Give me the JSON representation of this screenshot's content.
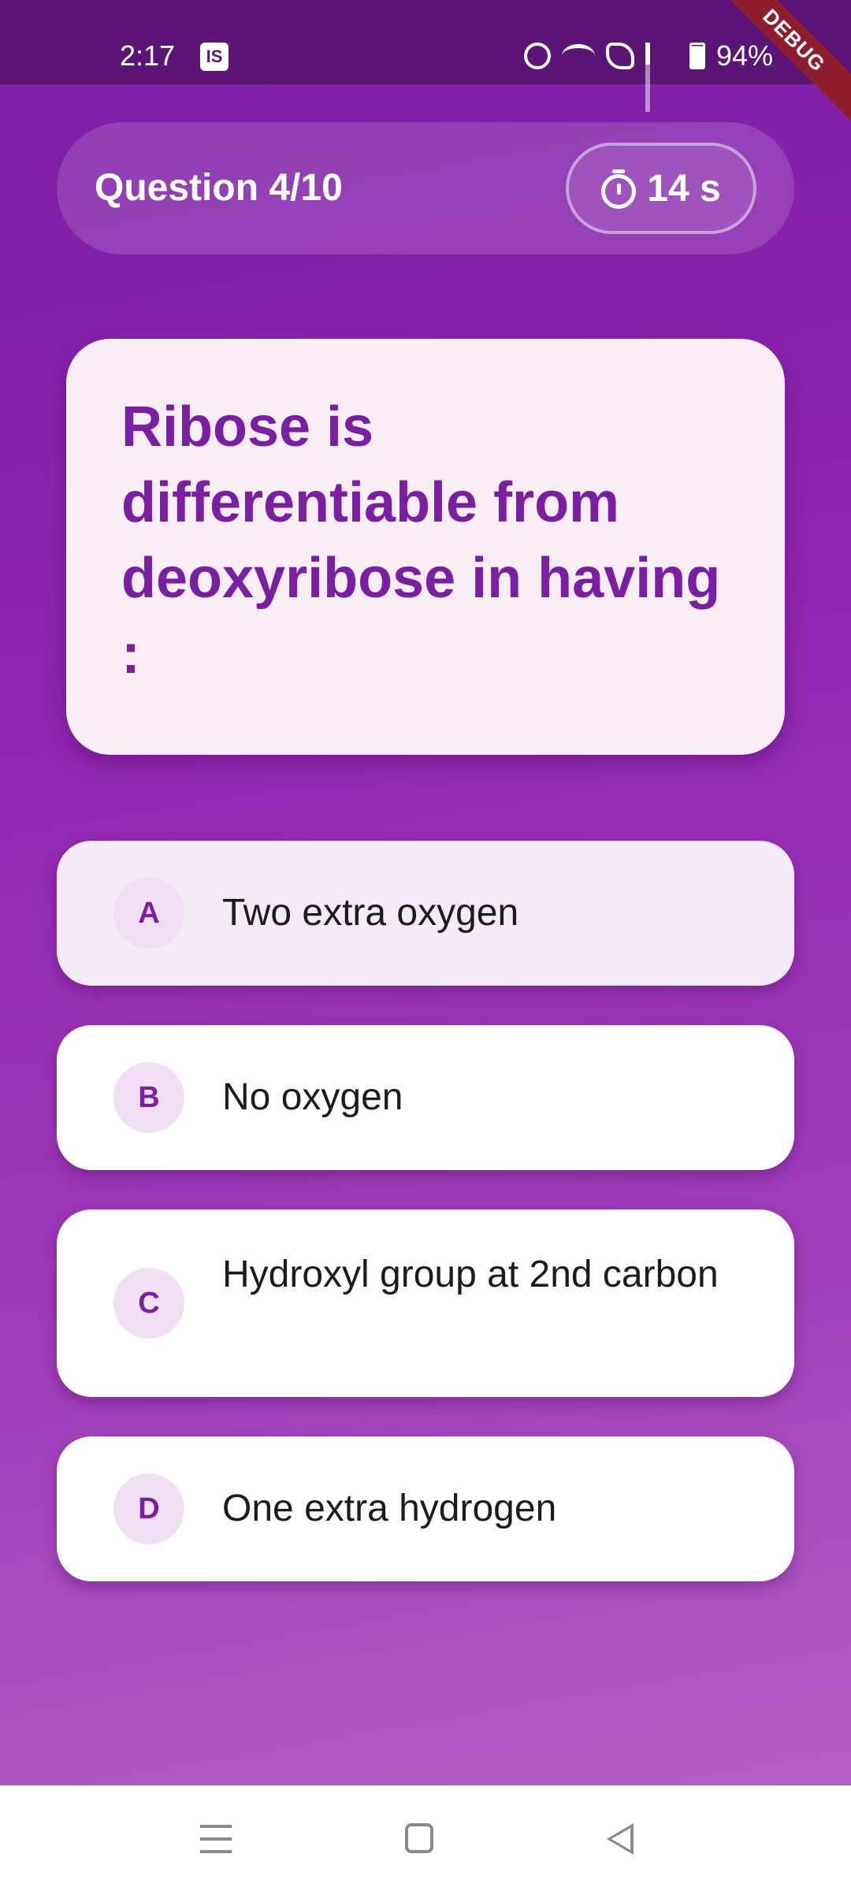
{
  "status_bar": {
    "time": "2:17",
    "app_badge": "IS",
    "battery": "94%",
    "debug_banner": "DEBUG"
  },
  "header": {
    "question_counter": "Question 4/10",
    "timer": "14 s"
  },
  "question": {
    "text": "Ribose is differentiable from deoxyribose in having :"
  },
  "options": [
    {
      "letter": "A",
      "text": "Two extra oxygen",
      "selected": true
    },
    {
      "letter": "B",
      "text": "No oxygen",
      "selected": false
    },
    {
      "letter": "C",
      "text": "Hydroxyl group at 2nd carbon",
      "selected": false
    },
    {
      "letter": "D",
      "text": "One extra hydrogen",
      "selected": false
    }
  ],
  "icons": {
    "timer": "stopwatch-icon",
    "nav": [
      "recents-icon",
      "home-icon",
      "back-icon"
    ]
  },
  "colors": {
    "accent": "#7b1fa2",
    "background_top": "#7c1fa6",
    "background_bottom": "#b866c8",
    "card": "#f9eef5"
  }
}
